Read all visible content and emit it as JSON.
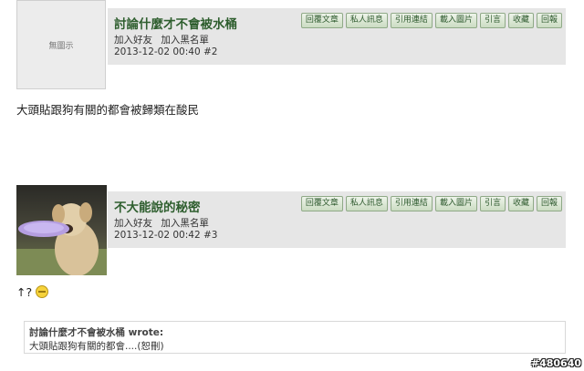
{
  "buttons": [
    "回覆文章",
    "私人訊息",
    "引用連結",
    "載入圖片",
    "引言",
    "收藏",
    "回報"
  ],
  "post1": {
    "avatar_placeholder": "無圖示",
    "title": "討論什麼才不會被水桶",
    "links": [
      "加入好友",
      "加入黑名單"
    ],
    "datetime": "2013-12-02 00:40",
    "post_no": "#2",
    "body": "大頭貼跟狗有關的都會被歸類在酸民"
  },
  "post2": {
    "title": "不大能說的秘密",
    "links": [
      "加入好友",
      "加入黑名單"
    ],
    "datetime": "2013-12-02 00:42",
    "post_no": "#3",
    "body": "↑?",
    "emoticon": "smile-emoticon-icon",
    "quote": {
      "author": "討論什麼才不會被水桶 wrote:",
      "text": "大頭貼跟狗有關的都會....(恕刪)"
    }
  },
  "watermark": "#480640",
  "colors": {
    "header_bg": "#e6e6e6",
    "title": "#2e5e2e",
    "button_bg": "#cbdcc2"
  }
}
